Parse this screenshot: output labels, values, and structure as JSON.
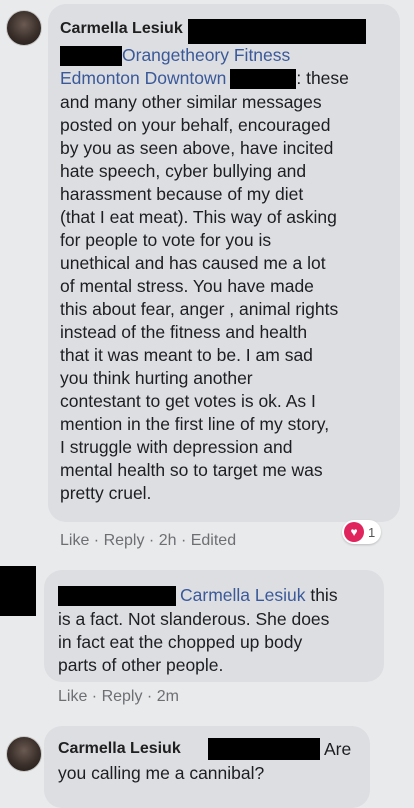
{
  "comment1": {
    "author": "Carmella Lesiuk",
    "tag_business": "Orangetheory Fitness",
    "tag_location": "Edmonton Downtown",
    "lines": [
      ": these",
      "and many other similar messages",
      "posted on your behalf, encouraged",
      "by you as seen above, have incited",
      "hate speech, cyber bullying and",
      "harassment because of my diet",
      "(that I eat meat). This way of asking",
      "for people to vote for you is",
      "unethical and has caused me a lot",
      "of mental stress. You have made",
      "this about fear, anger , animal rights",
      "instead of the fitness and health",
      "that it was meant to be. I am sad",
      "you think hurting another",
      "contestant to get votes is ok. As I",
      "mention in the first line of my story,",
      "I struggle with depression and",
      "mental health so to target me was",
      "pretty cruel."
    ],
    "actions": {
      "like": "Like",
      "sep1": " · ",
      "reply": "Reply",
      "sep2": " · ",
      "time": "2h",
      "sep3": " · ",
      "edited": "Edited"
    },
    "reaction_count": "1",
    "reaction_icon": "heart-icon"
  },
  "comment2": {
    "mention": "Carmella Lesiuk",
    "line1_after": " this",
    "lines": [
      "is a fact. Not slanderous. She does",
      "in fact eat the chopped up body",
      "parts of other people."
    ],
    "actions": {
      "like": "Like",
      "sep1": " · ",
      "reply": "Reply",
      "sep2": " · ",
      "time": "2m"
    }
  },
  "comment3": {
    "author": "Carmella Lesiuk",
    "after_redact": "Are",
    "line2": "you calling me a cannibal?"
  },
  "colors": {
    "tag": "#3b5998",
    "reaction": "#e0245e",
    "bubble": "#dcdee2",
    "background": "#e9eaec"
  }
}
